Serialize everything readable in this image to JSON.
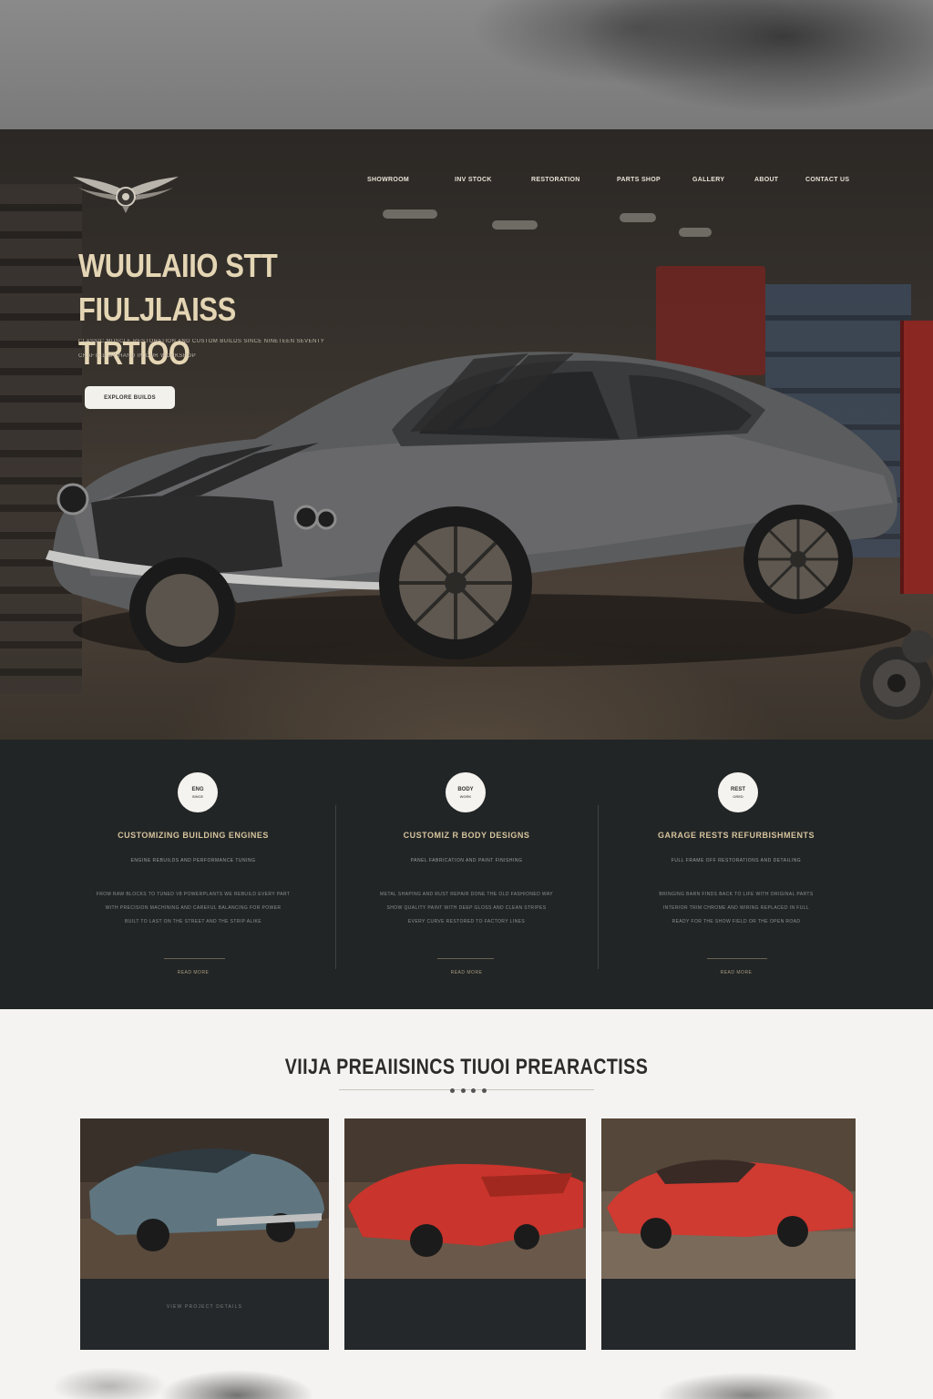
{
  "nav": {
    "items": [
      "SHOWROOM",
      "INV STOCK",
      "RESTORATION",
      "PARTS SHOP",
      "GALLERY",
      "ABOUT",
      "CONTACT US"
    ]
  },
  "hero": {
    "title_line1": "WUULAIIO STT",
    "title_line2": "FIULJLAISS TIRTIOO",
    "sub_line1": "CLASSIC MUSCLE RESTORATION AND CUSTOM BUILDS SINCE NINETEEN SEVENTY",
    "sub_line2": "CRAFTED BY HAND IN OUR WORKSHOP",
    "cta_label": "EXPLORE BUILDS"
  },
  "features": [
    {
      "icon_top": "ENG",
      "icon_bottom": "SINCE",
      "title": "CUSTOMIZING BUILDING ENGINES",
      "tag": "ENGINE REBUILDS AND PERFORMANCE TUNING",
      "lines": [
        "FROM RAW BLOCKS TO TUNED V8 POWERPLANTS WE REBUILD EVERY PART",
        "WITH PRECISION MACHINING AND CAREFUL BALANCING FOR POWER",
        "BUILT TO LAST ON THE STREET AND THE STRIP ALIKE"
      ],
      "link": "READ MORE"
    },
    {
      "icon_top": "BODY",
      "icon_bottom": "WORK",
      "title": "CUSTOMIZ R BODY DESIGNS",
      "tag": "PANEL FABRICATION AND PAINT FINISHING",
      "lines": [
        "METAL SHAPING AND RUST REPAIR DONE THE OLD FASHIONED WAY",
        "SHOW QUALITY PAINT WITH DEEP GLOSS AND CLEAN STRIPES",
        "EVERY CURVE RESTORED TO FACTORY LINES"
      ],
      "link": "READ MORE"
    },
    {
      "icon_top": "REST",
      "icon_bottom": "ORED",
      "title": "GARAGE RESTS REFURBISHMENTS",
      "tag": "FULL FRAME OFF RESTORATIONS AND DETAILING",
      "lines": [
        "BRINGING BARN FINDS BACK TO LIFE WITH ORIGINAL PARTS",
        "INTERIOR TRIM CHROME AND WIRING REPLACED IN FULL",
        "READY FOR THE SHOW FIELD OR THE OPEN ROAD"
      ],
      "link": "READ MORE"
    }
  ],
  "gallery": {
    "title": "VIIJA PREAIISINCS TIUOI PREARACTISS",
    "cards": [
      {
        "caption": "VIEW PROJECT DETAILS",
        "car_color": "#5f7680"
      },
      {
        "caption": "",
        "car_color": "#c9342c"
      },
      {
        "caption": "",
        "car_color": "#cf3a31"
      }
    ]
  },
  "colors": {
    "accent_gold": "#d6c49d",
    "dark_panel": "#222526",
    "hero_title": "#e4d5b4"
  }
}
